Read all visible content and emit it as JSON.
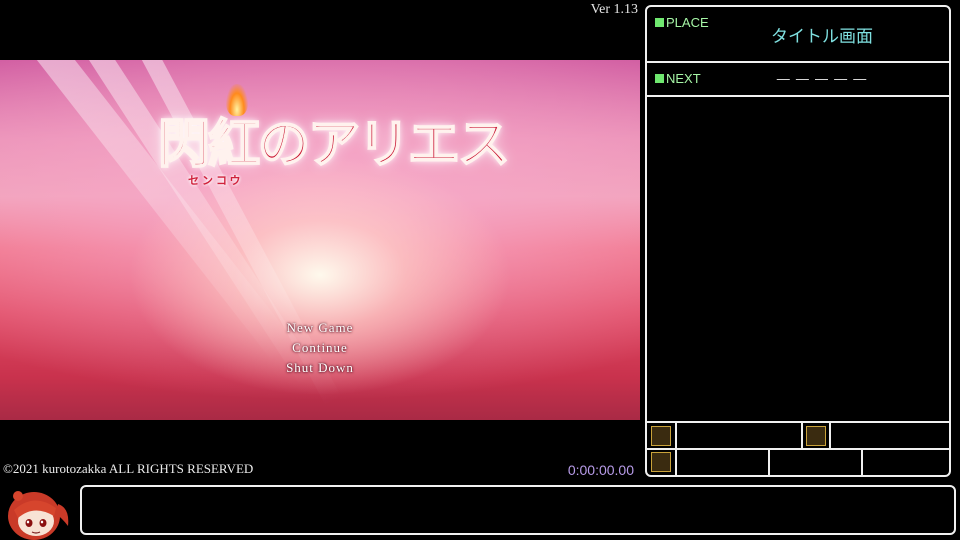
{
  "game": {
    "version": "Ver 1.13",
    "logo_title": "閃紅のアリエス",
    "logo_ruby": "センコウ",
    "menu": [
      "New Game",
      "Continue",
      "Shut Down"
    ],
    "copyright": "©2021 kurotozakka ALL RIGHTS RESERVED"
  },
  "overlay": {
    "timer": "0:00:00.00",
    "place_label": "PLACE",
    "place_value": "タイトル画面",
    "next_label": "NEXT",
    "next_value": "― ― ― ― ―"
  },
  "colors": {
    "label_green": "#a6f6a6",
    "place_cyan": "#7fe0e0",
    "timer_purple": "#b79be8",
    "title_red": "#c8102e"
  },
  "icons": [
    "wand-icon",
    "armor-icon",
    "ring-icon",
    "yukkuri-avatar"
  ]
}
